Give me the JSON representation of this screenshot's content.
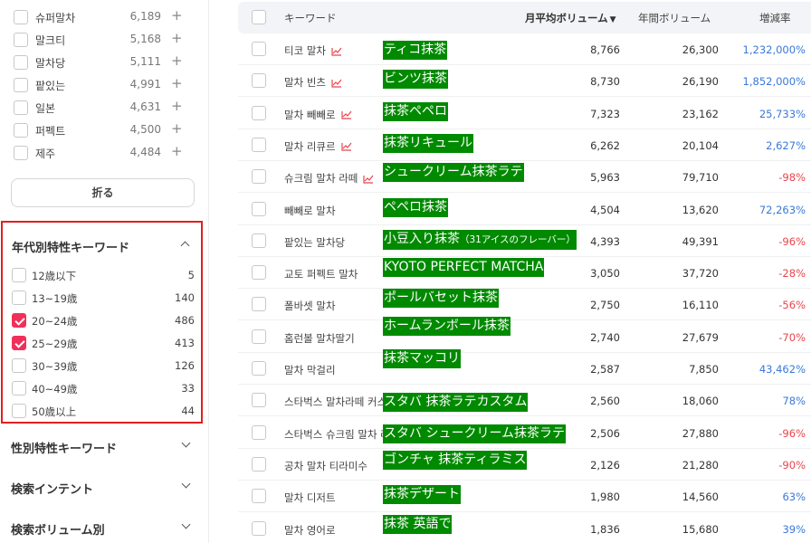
{
  "sidebar": {
    "keywords": [
      {
        "label": "슈퍼말차",
        "count": "6,189",
        "plus": "+"
      },
      {
        "label": "말크티",
        "count": "5,168",
        "plus": "+"
      },
      {
        "label": "말차당",
        "count": "5,111",
        "plus": "+"
      },
      {
        "label": "팥있는",
        "count": "4,991",
        "plus": "+"
      },
      {
        "label": "일본",
        "count": "4,631",
        "plus": "+"
      },
      {
        "label": "퍼펙트",
        "count": "4,500",
        "plus": "+"
      },
      {
        "label": "제주",
        "count": "4,484",
        "plus": "+"
      }
    ],
    "fold_label": "折る",
    "age_section": {
      "title": "年代別特性キーワード",
      "items": [
        {
          "label": "12歳以下",
          "count": "5",
          "checked": false
        },
        {
          "label": "13~19歳",
          "count": "140",
          "checked": false
        },
        {
          "label": "20~24歳",
          "count": "486",
          "checked": true
        },
        {
          "label": "25~29歳",
          "count": "413",
          "checked": true
        },
        {
          "label": "30~39歳",
          "count": "126",
          "checked": false
        },
        {
          "label": "40~49歳",
          "count": "33",
          "checked": false
        },
        {
          "label": "50歳以上",
          "count": "44",
          "checked": false
        }
      ]
    },
    "sections": [
      {
        "title": "性別特性キーワード"
      },
      {
        "title": "検索インテント"
      },
      {
        "title": "検索ボリューム別"
      }
    ]
  },
  "table": {
    "headers": {
      "keyword": "キーワード",
      "monthly": "月平均ボリューム",
      "monthly_sort": "▼",
      "annual": "年間ボリューム",
      "rate": "増減率"
    },
    "rows": [
      {
        "keyword": "티코 말차",
        "trend": true,
        "jp": "ティコ抹茶",
        "jp_small": "",
        "monthly": "8,766",
        "annual": "26,300",
        "rate": "1,232,000%",
        "dir": "pos"
      },
      {
        "keyword": "말차 빈츠",
        "trend": true,
        "jp": "ビンツ抹茶",
        "jp_small": "",
        "monthly": "8,730",
        "annual": "26,190",
        "rate": "1,852,000%",
        "dir": "pos"
      },
      {
        "keyword": "말차 빼빼로",
        "trend": true,
        "jp": "抹茶ペペロ",
        "jp_small": "",
        "monthly": "7,323",
        "annual": "23,162",
        "rate": "25,733%",
        "dir": "pos"
      },
      {
        "keyword": "말차 리큐르",
        "trend": true,
        "jp": "抹茶リキュール",
        "jp_small": "",
        "monthly": "6,262",
        "annual": "20,104",
        "rate": "2,627%",
        "dir": "pos"
      },
      {
        "keyword": "슈크림 말차 라떼",
        "trend": true,
        "jp": "シュークリーム抹茶ラテ",
        "jp_small": "",
        "monthly": "5,963",
        "annual": "79,710",
        "rate": "-98%",
        "dir": "neg"
      },
      {
        "keyword": "빼빼로 말차",
        "trend": false,
        "jp": "ペペロ抹茶",
        "jp_small": "",
        "monthly": "4,504",
        "annual": "13,620",
        "rate": "72,263%",
        "dir": "pos"
      },
      {
        "keyword": "팥있는 말차당",
        "trend": false,
        "jp": "小豆入り抹茶",
        "jp_small": "（31アイスのフレーバー）",
        "monthly": "4,393",
        "annual": "49,391",
        "rate": "-96%",
        "dir": "neg"
      },
      {
        "keyword": "교토 퍼펙트 말차",
        "trend": false,
        "jp": "KYOTO PERFECT MATCHA",
        "jp_small": "",
        "monthly": "3,050",
        "annual": "37,720",
        "rate": "-28%",
        "dir": "neg"
      },
      {
        "keyword": "폴바셋 말차",
        "trend": false,
        "jp": "ポールバセット抹茶",
        "jp_small": "",
        "monthly": "2,750",
        "annual": "16,110",
        "rate": "-56%",
        "dir": "neg"
      },
      {
        "keyword": "홈런볼 말차딸기",
        "trend": false,
        "jp": "ホームランボール抹茶",
        "jp_small": "",
        "monthly": "2,740",
        "annual": "27,679",
        "rate": "-70%",
        "dir": "neg"
      },
      {
        "keyword": "말차 막걸리",
        "trend": false,
        "jp": "抹茶マッコリ",
        "jp_small": "",
        "monthly": "2,587",
        "annual": "7,850",
        "rate": "43,462%",
        "dir": "pos"
      },
      {
        "keyword": "스타벅스 말차라떼 커스텀",
        "trend": false,
        "jp": "スタバ 抹茶ラテカスタム",
        "jp_small": "",
        "monthly": "2,560",
        "annual": "18,060",
        "rate": "78%",
        "dir": "pos"
      },
      {
        "keyword": "스타벅스 슈크림 말차 라떼",
        "trend": false,
        "jp": "スタバ シュークリーム抹茶ラテ",
        "jp_small": "",
        "monthly": "2,506",
        "annual": "27,880",
        "rate": "-96%",
        "dir": "neg"
      },
      {
        "keyword": "공차 말차 티라미수",
        "trend": false,
        "jp": "ゴンチャ 抹茶ティラミス",
        "jp_small": "",
        "monthly": "2,126",
        "annual": "21,280",
        "rate": "-90%",
        "dir": "neg"
      },
      {
        "keyword": "말차 디저트",
        "trend": false,
        "jp": "抹茶デザート",
        "jp_small": "",
        "monthly": "1,980",
        "annual": "14,560",
        "rate": "63%",
        "dir": "pos"
      },
      {
        "keyword": "말차 영어로",
        "trend": false,
        "jp": "抹茶 英語で",
        "jp_small": "",
        "monthly": "1,836",
        "annual": "15,680",
        "rate": "39%",
        "dir": "pos"
      }
    ]
  }
}
